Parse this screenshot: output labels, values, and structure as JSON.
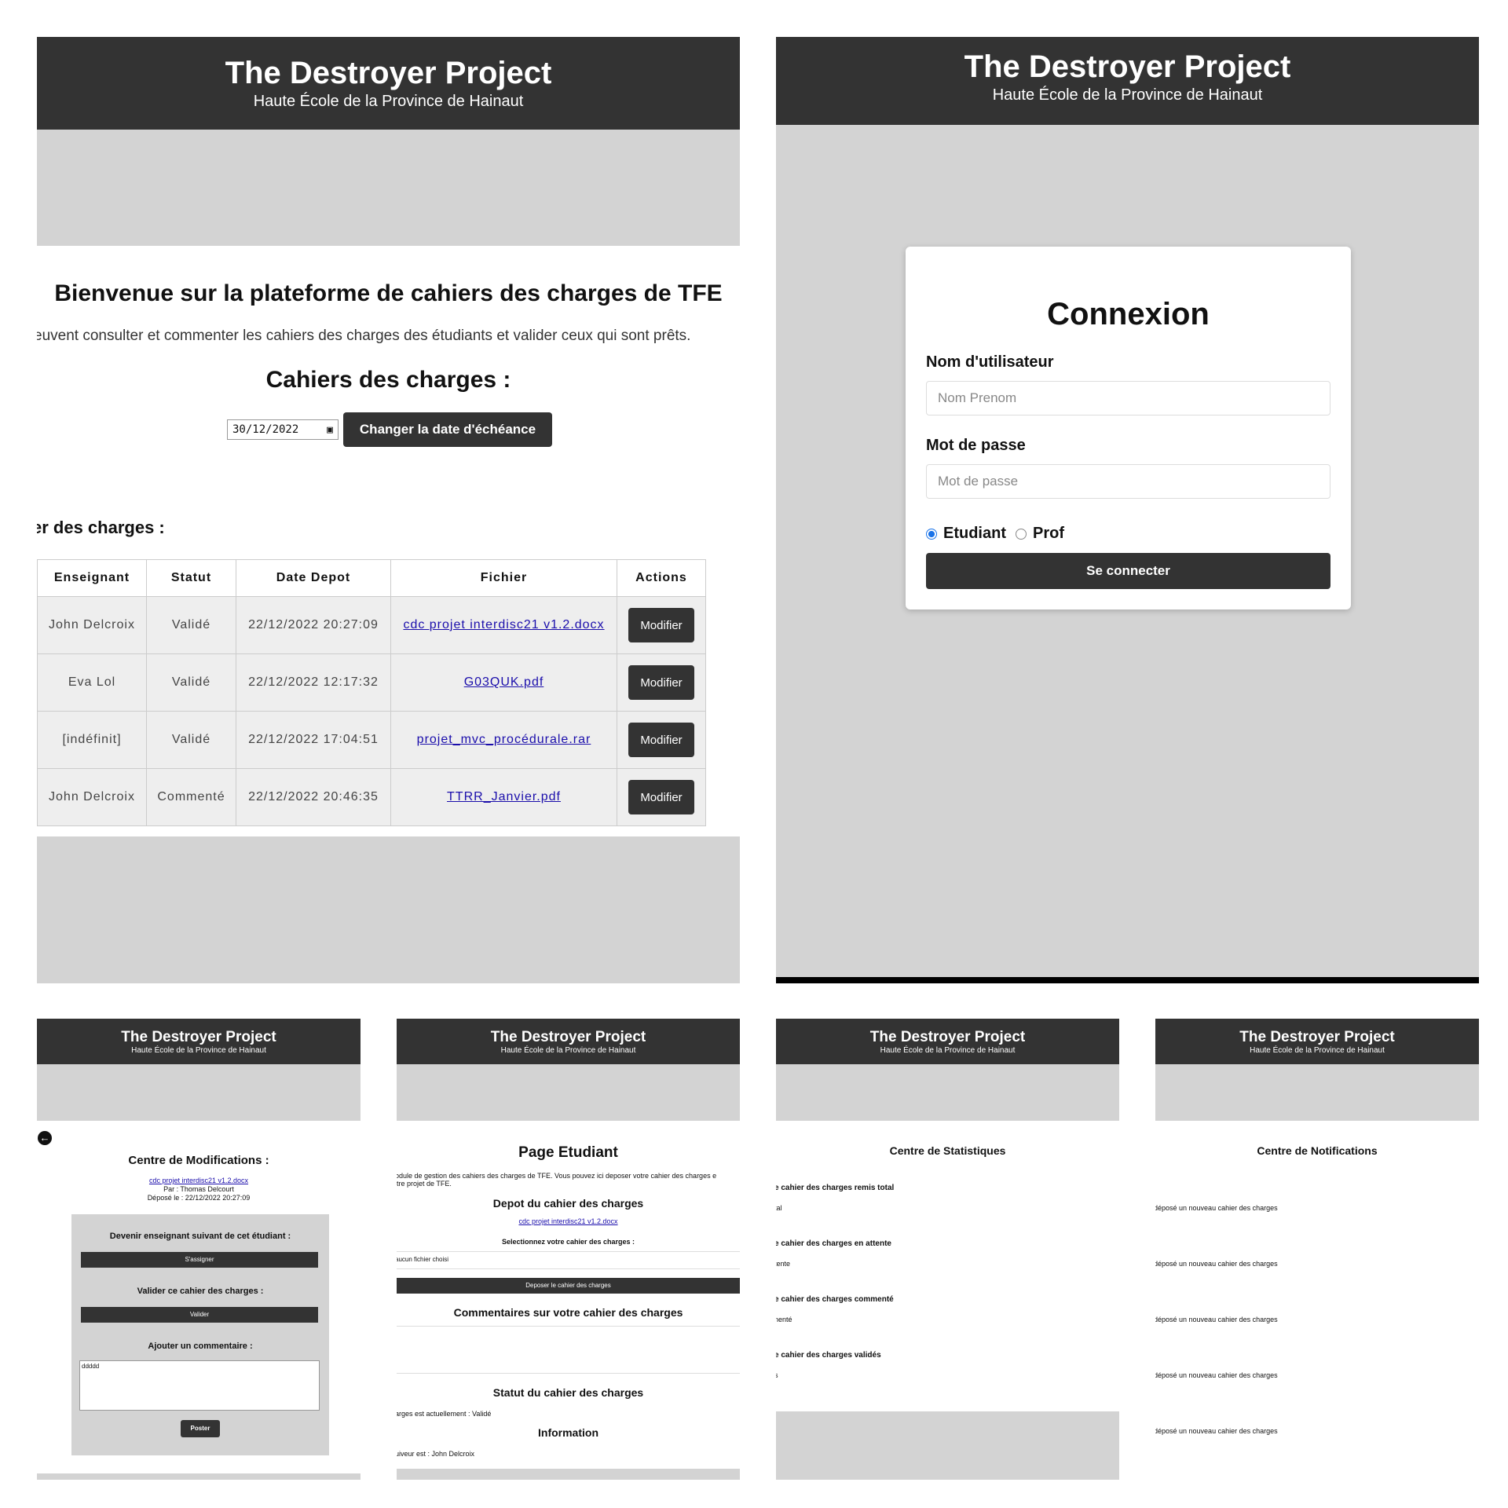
{
  "app": {
    "title": "The Destroyer Project",
    "subtitle": "Haute École de la Province de Hainaut"
  },
  "teacher_page": {
    "heading": "Bienvenue sur la plateforme de cahiers des charges de TFE",
    "intro": "euvent consulter et commenter les cahiers des charges des étudiants et valider ceux qui sont prêts.",
    "section_title": "Cahiers des charges :",
    "due_date_value": "30/12/2022",
    "change_date_button": "Changer la date d'échéance",
    "table_title": "er des charges :",
    "columns": [
      "Enseignant",
      "Statut",
      "Date Depot",
      "Fichier",
      "Actions"
    ],
    "rows": [
      {
        "enseignant": "John Delcroix",
        "statut": "Validé",
        "date": "22/12/2022 20:27:09",
        "fichier": "cdc projet interdisc21 v1.2.docx",
        "action": "Modifier"
      },
      {
        "enseignant": "Eva Lol",
        "statut": "Validé",
        "date": "22/12/2022 12:17:32",
        "fichier": "G03QUK.pdf",
        "action": "Modifier"
      },
      {
        "enseignant": "[indéfinit]",
        "statut": "Validé",
        "date": "22/12/2022 17:04:51",
        "fichier": "projet_mvc_procédurale.rar",
        "action": "Modifier"
      },
      {
        "enseignant": "John Delcroix",
        "statut": "Commenté",
        "date": "22/12/2022 20:46:35",
        "fichier": "TTRR_Janvier.pdf",
        "action": "Modifier"
      }
    ]
  },
  "login": {
    "title": "Connexion",
    "username_label": "Nom d'utilisateur",
    "username_placeholder": "Nom Prenom",
    "password_label": "Mot de passe",
    "password_placeholder": "Mot de passe",
    "role_student": "Etudiant",
    "role_prof": "Prof",
    "selected_role": "Etudiant",
    "submit": "Se connecter"
  },
  "modifications": {
    "title": "Centre de Modifications :",
    "file_link": "cdc projet interdisc21 v1.2.docx",
    "by": "Par : Thomas Delcourt",
    "deposited": "Déposé le : 22/12/2022 20:27:09",
    "assign_label": "Devenir enseignant suivant de cet étudiant :",
    "assign_button": "S'assigner",
    "validate_label": "Valider ce cahier des charges :",
    "validate_button": "Valider",
    "comment_label": "Ajouter un commentaire :",
    "comment_value": "ddddd",
    "post_button": "Poster"
  },
  "student_page": {
    "title": "Page Etudiant",
    "intro": "odule de gestion des cahiers des charges de TFE. Vous pouvez ici deposer votre cahier des charges e\nitre projet de TFE.",
    "deposit_title": "Depot du cahier des charges",
    "file_link": "cdc projet interdisc21 v1.2.docx",
    "select_label": "Selectionnez votre cahier des charges :",
    "no_file": "aucun fichier choisi",
    "deposit_button": "Deposer le cahier des charges",
    "comments_title": "Commentaires sur votre cahier des charges",
    "status_title": "Statut du cahier des charges",
    "status_text": "arges est actuellement : Validé",
    "info_title": "Information",
    "info_text": "uiveur est : John Delcroix"
  },
  "stats": {
    "title": "Centre de Statistiques",
    "items": [
      {
        "label": "e cahier des charges remis total",
        "value": "tal"
      },
      {
        "label": "e cahier des charges en attente",
        "value": "tente"
      },
      {
        "label": "e cahier des charges commenté",
        "value": "nenté"
      },
      {
        "label": "e cahier des charges validés",
        "value": "s"
      }
    ]
  },
  "notifications": {
    "title": "Centre de Notifications",
    "items": [
      "déposé un nouveau cahier des charges",
      "déposé un nouveau cahier des charges",
      "déposé un nouveau cahier des charges",
      "déposé un nouveau cahier des charges",
      "déposé un nouveau cahier des charges"
    ]
  }
}
